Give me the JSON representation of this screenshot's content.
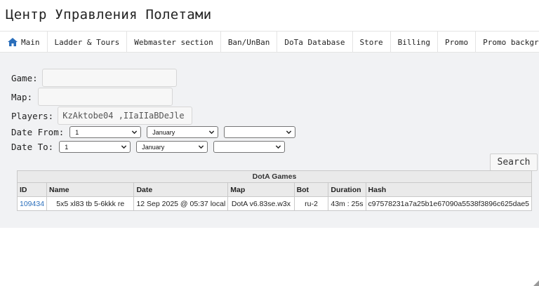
{
  "site": {
    "title": "Центр Управления Полетами"
  },
  "nav": {
    "items": [
      {
        "label": "Main",
        "icon": "home-icon"
      },
      {
        "label": "Ladder & Tours"
      },
      {
        "label": "Webmaster section"
      },
      {
        "label": "Ban/UnBan"
      },
      {
        "label": "DoTa Database"
      },
      {
        "label": "Store"
      },
      {
        "label": "Billing"
      },
      {
        "label": "Promo"
      },
      {
        "label": "Promo background"
      }
    ]
  },
  "form": {
    "game_label": "Game:",
    "game_value": "",
    "map_label": "Map:",
    "map_value": "",
    "players_label": "Players:",
    "players_value": "KzAktobe04 ,IIaIIaBDeJle",
    "date_from_label": "Date From:",
    "date_to_label": "Date To:",
    "from_day": "1",
    "from_month": "January",
    "from_year": "",
    "to_day": "1",
    "to_month": "January",
    "to_year": "",
    "search_label": "Search"
  },
  "table": {
    "caption": "DotA Games",
    "columns": [
      "ID",
      "Name",
      "Date",
      "Map",
      "Bot",
      "Duration",
      "Hash"
    ],
    "rows": [
      {
        "id": "109434",
        "name": "5x5 xl83 tb 5-6kkk re",
        "date": "12 Sep 2025 @ 05:37 local",
        "map": "DotA v6.83se.w3x",
        "bot": "ru-2",
        "duration": "43m : 25s",
        "hash": "c97578231a7a25b1e67090a5538f3896c625dae5"
      }
    ]
  },
  "colors": {
    "link": "#2a6ebb",
    "nav_icon": "#2a6ebb",
    "panel_bg": "#f1f2f4"
  }
}
